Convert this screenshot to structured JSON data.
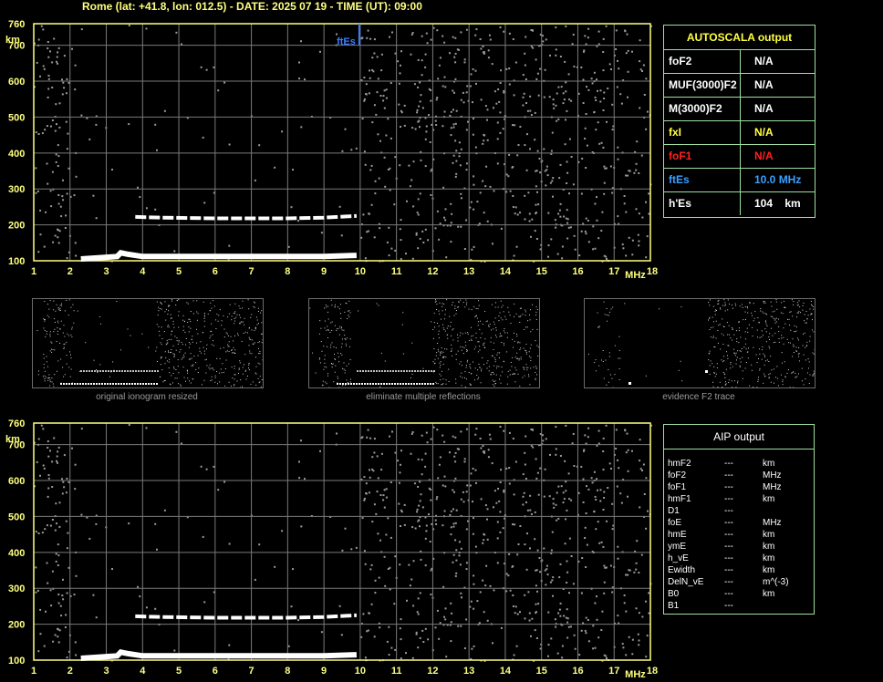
{
  "title": "Rome (lat: +41.8, lon: 012.5) - DATE: 2025 07 19 - TIME (UT): 09:00",
  "chart_data": [
    {
      "type": "scatter",
      "name_hidden": "",
      "x_unit": "MHz",
      "y_unit": "km",
      "xlim": [
        1,
        18
      ],
      "ylim": [
        100,
        760
      ],
      "x_ticks": [
        "1",
        "2",
        "3",
        "4",
        "5",
        "6",
        "7",
        "8",
        "9",
        "10",
        "11",
        "12",
        "13",
        "14",
        "15",
        "16",
        "17",
        "18"
      ],
      "y_ticks": [
        "100",
        "200",
        "300",
        "400",
        "500",
        "600",
        "700",
        "760"
      ],
      "marker_label": "ftEs",
      "marker_x": 10.0,
      "trace_low": [
        [
          2.3,
          105
        ],
        [
          3.3,
          112
        ],
        [
          3.4,
          122
        ],
        [
          3.6,
          118
        ],
        [
          4.0,
          112
        ],
        [
          5.0,
          112
        ],
        [
          6.0,
          112
        ],
        [
          7.0,
          112
        ],
        [
          8.0,
          112
        ],
        [
          9.0,
          112
        ],
        [
          9.9,
          115
        ]
      ],
      "trace_high": [
        [
          3.8,
          222
        ],
        [
          4.5,
          220
        ],
        [
          6.0,
          218
        ],
        [
          7.0,
          218
        ],
        [
          8.0,
          218
        ],
        [
          9.0,
          220
        ],
        [
          9.9,
          225
        ]
      ]
    },
    {
      "type": "scatter",
      "x_unit": "MHz",
      "y_unit": "km",
      "xlim": [
        1,
        18
      ],
      "ylim": [
        100,
        760
      ],
      "x_ticks": [
        "1",
        "2",
        "3",
        "4",
        "5",
        "6",
        "7",
        "8",
        "9",
        "10",
        "11",
        "12",
        "13",
        "14",
        "15",
        "16",
        "17",
        "18"
      ],
      "y_ticks": [
        "100",
        "200",
        "300",
        "400",
        "500",
        "600",
        "700",
        "760"
      ],
      "trace_low": [
        [
          2.3,
          105
        ],
        [
          3.3,
          112
        ],
        [
          3.4,
          122
        ],
        [
          3.6,
          118
        ],
        [
          4.0,
          112
        ],
        [
          5.0,
          112
        ],
        [
          6.0,
          112
        ],
        [
          7.0,
          112
        ],
        [
          8.0,
          112
        ],
        [
          9.0,
          112
        ],
        [
          9.9,
          115
        ]
      ],
      "trace_high": [
        [
          3.8,
          222
        ],
        [
          4.5,
          220
        ],
        [
          6.0,
          218
        ],
        [
          7.0,
          218
        ],
        [
          8.0,
          218
        ],
        [
          9.0,
          220
        ],
        [
          9.9,
          225
        ]
      ]
    }
  ],
  "thumbnails": [
    {
      "caption": "original ionogram resized"
    },
    {
      "caption": "eliminate multiple reflections"
    },
    {
      "caption": "evidence F2 trace"
    }
  ],
  "autoscala": {
    "title": "AUTOSCALA output",
    "rows": [
      {
        "name": "foF2",
        "value": "N/A",
        "color": "#ffffff"
      },
      {
        "name": "MUF(3000)F2",
        "value": "N/A",
        "color": "#ffffff"
      },
      {
        "name": "M(3000)F2",
        "value": "N/A",
        "color": "#ffffff"
      },
      {
        "name": "fxI",
        "value": "N/A",
        "color": "#ffff40"
      },
      {
        "name": "foF1",
        "value": "N/A",
        "color": "#ff2020"
      },
      {
        "name": "ftEs",
        "value": "10.0 MHz",
        "color": "#3aa0ff"
      },
      {
        "name": "h'Es",
        "value": "104    km",
        "color": "#ffffff"
      }
    ]
  },
  "aip": {
    "title": "AIP output",
    "rows": [
      {
        "name": "hmF2",
        "value": "---",
        "unit": "km"
      },
      {
        "name": "foF2",
        "value": "---",
        "unit": "MHz"
      },
      {
        "name": "foF1",
        "value": "---",
        "unit": "MHz"
      },
      {
        "name": "hmF1",
        "value": "---",
        "unit": "km"
      },
      {
        "name": "D1",
        "value": "---",
        "unit": ""
      },
      {
        "name": "foE",
        "value": "---",
        "unit": "MHz"
      },
      {
        "name": "hmE",
        "value": "---",
        "unit": "km"
      },
      {
        "name": "ymE",
        "value": "---",
        "unit": "km"
      },
      {
        "name": "h_vE",
        "value": "---",
        "unit": "km"
      },
      {
        "name": "Ewidth",
        "value": "---",
        "unit": "km"
      },
      {
        "name": "DelN_vE",
        "value": "---",
        "unit": "m^(-3)"
      },
      {
        "name": "B0",
        "value": "---",
        "unit": "km"
      },
      {
        "name": "B1",
        "value": "---",
        "unit": ""
      }
    ]
  },
  "colors": {
    "grid": "#7a7a7a",
    "frame": "#ffff80",
    "label": "#ffff80",
    "marker": "#3a7dff",
    "trace": "#ffffff",
    "noise": "#9a9a9a"
  }
}
